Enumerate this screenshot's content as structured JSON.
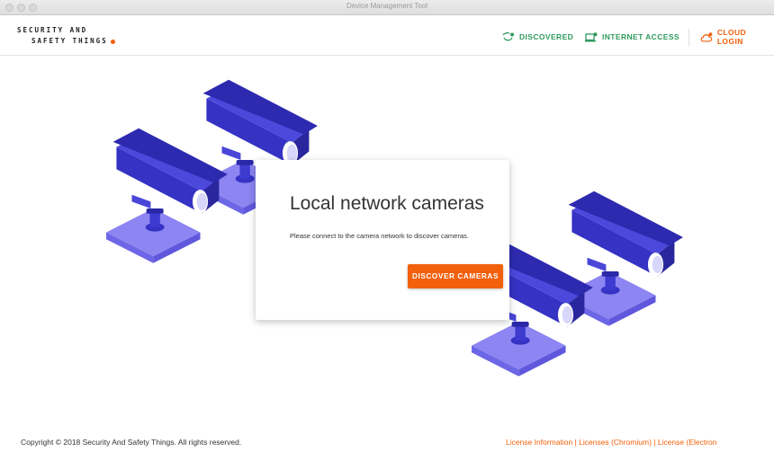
{
  "window": {
    "title": "Device Management Tool"
  },
  "logo": {
    "line1": "SECURITY AND",
    "line2": "SAFETY THINGS"
  },
  "nav": {
    "discovered": "DISCOVERED",
    "internet_access": "INTERNET ACCESS",
    "cloud_login": "CLOUD LOGIN"
  },
  "card": {
    "title": "Local network cameras",
    "text": "Please connect to the camera network to discover cameras.",
    "button": "DISCOVER CAMERAS"
  },
  "footer": {
    "copyright": "Copyright © 2018 Security And Safety Things. All rights reserved.",
    "links": [
      "License Information",
      "Licenses (Chromium)",
      "License (Electron"
    ],
    "separator": " | "
  },
  "colors": {
    "accent_orange": "#f2600c",
    "status_green": "#2e9b5e",
    "camera_dark": "#3532c4",
    "camera_mid": "#5b57e0",
    "platform": "#8c85f2"
  },
  "icons": [
    "discovered-icon",
    "internet-access-icon",
    "cloud-login-icon"
  ]
}
